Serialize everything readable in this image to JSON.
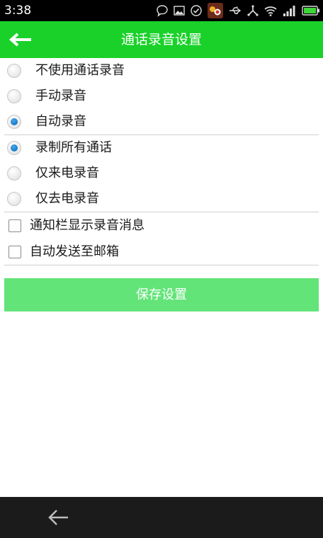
{
  "status_bar": {
    "time": "3:38"
  },
  "header": {
    "title": "通话录音设置"
  },
  "record_mode": [
    {
      "label": "不使用通话录音",
      "checked": false
    },
    {
      "label": "手动录音",
      "checked": false
    },
    {
      "label": "自动录音",
      "checked": true
    }
  ],
  "record_scope": [
    {
      "label": "录制所有通话",
      "checked": true
    },
    {
      "label": "仅来电录音",
      "checked": false
    },
    {
      "label": "仅去电录音",
      "checked": false
    }
  ],
  "options": [
    {
      "label": "通知栏显示录音消息",
      "checked": false
    },
    {
      "label": "自动发送至邮箱",
      "checked": false
    }
  ],
  "save_button": {
    "label": "保存设置"
  },
  "colors": {
    "accent": "#1ad12a",
    "button": "#63e479",
    "radio_selected": "#1479c8"
  }
}
